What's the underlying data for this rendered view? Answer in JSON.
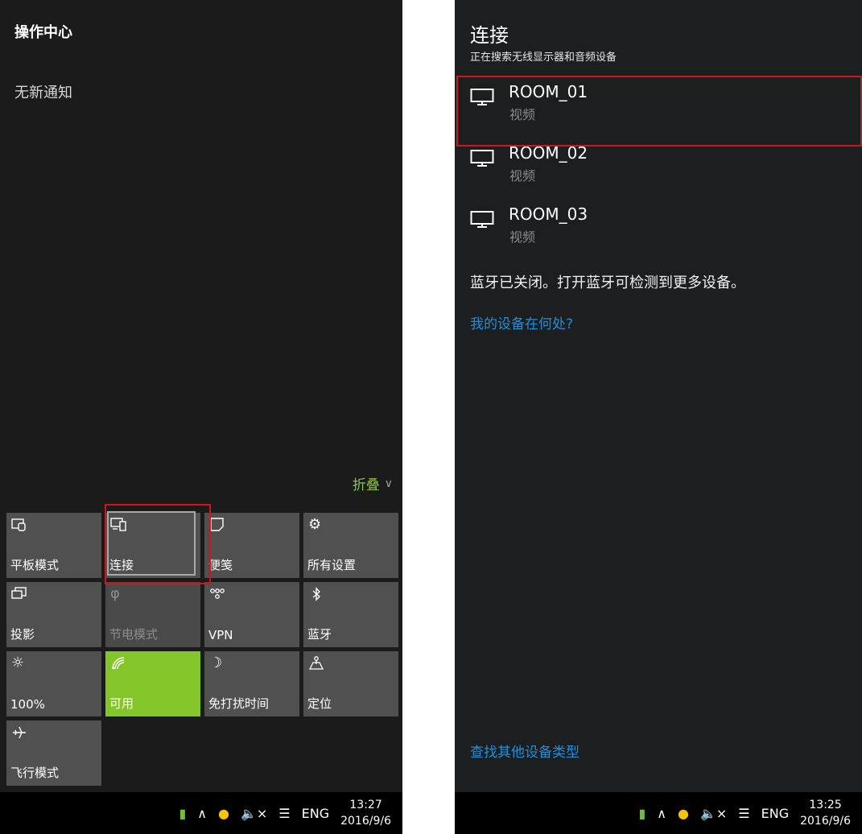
{
  "action_center": {
    "title": "操作中心",
    "no_notifications": "无新通知",
    "collapse": "折叠",
    "tiles": [
      {
        "label": "平板模式",
        "icon": "tablet-mode-icon",
        "state": "off"
      },
      {
        "label": "连接",
        "icon": "connect-icon",
        "state": "off"
      },
      {
        "label": "便笺",
        "icon": "note-icon",
        "state": "off"
      },
      {
        "label": "所有设置",
        "icon": "gear-icon",
        "state": "off"
      },
      {
        "label": "投影",
        "icon": "project-icon",
        "state": "off"
      },
      {
        "label": "节电模式",
        "icon": "battery-saver-icon",
        "state": "disabled"
      },
      {
        "label": "VPN",
        "icon": "vpn-icon",
        "state": "off"
      },
      {
        "label": "蓝牙",
        "icon": "bluetooth-icon",
        "state": "off"
      },
      {
        "label": "100%",
        "icon": "brightness-icon",
        "state": "off"
      },
      {
        "label": "可用",
        "icon": "wifi-icon",
        "state": "on"
      },
      {
        "label": "免打扰时间",
        "icon": "moon-icon",
        "state": "off"
      },
      {
        "label": "定位",
        "icon": "location-icon",
        "state": "off"
      },
      {
        "label": "飞行模式",
        "icon": "airplane-icon",
        "state": "off"
      }
    ]
  },
  "taskbar_left": {
    "lang": "ENG",
    "time": "13:27",
    "date": "2016/9/6"
  },
  "connect_pane": {
    "title": "连接",
    "subtitle": "正在搜索无线显示器和音频设备",
    "devices": [
      {
        "name": "ROOM_01",
        "type": "视频"
      },
      {
        "name": "ROOM_02",
        "type": "视频"
      },
      {
        "name": "ROOM_03",
        "type": "视频"
      }
    ],
    "bluetooth_note": "蓝牙已关闭。打开蓝牙可检测到更多设备。",
    "where_link": "我的设备在何处?",
    "find_other_link": "查找其他设备类型"
  },
  "taskbar_right": {
    "lang": "ENG",
    "time": "13:25",
    "date": "2016/9/6"
  },
  "colors": {
    "accent_green": "#84c52a",
    "link_blue": "#1f8fd9",
    "highlight_red": "#d0161a"
  }
}
